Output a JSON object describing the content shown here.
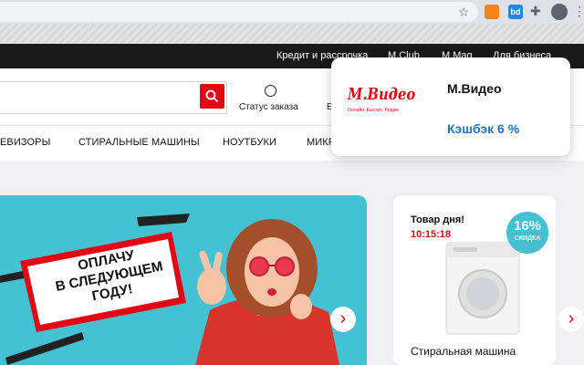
{
  "browser": {
    "extensions": [
      {
        "name": "fox-extension-icon",
        "label": ""
      },
      {
        "name": "bd-extension-icon",
        "label": "bd"
      }
    ]
  },
  "topbar": {
    "links": [
      "Кредит и рассрочка",
      "M.Club",
      "M.Mag",
      "Для бизнеса"
    ]
  },
  "header": {
    "order_status": "Статус заказа",
    "more_label": "Е"
  },
  "nav": {
    "items": [
      "ЕВИЗОРЫ",
      "СТИРАЛЬНЫЕ МАШИНЫ",
      "НОУТБУКИ",
      "МИКР"
    ]
  },
  "banner": {
    "lines": [
      "ОПЛАЧУ",
      "В СЛЕДУЮЩЕМ",
      "ГОДУ!"
    ]
  },
  "deal": {
    "title": "Товар дня!",
    "timer": "10:15:18",
    "discount": "16%",
    "discount_label": "СКИДКА",
    "product_name": "Стиральная машина"
  },
  "popup": {
    "logo_text": "М.Видео",
    "logo_tagline": "Онлайн. Быстро. Рядом.",
    "store_name": "М.Видео",
    "cashback": "Кэшбэк 6 %"
  },
  "colors": {
    "brand_red": "#e30613",
    "banner_bg": "#45c1d4",
    "cashback_blue": "#1f72c4",
    "topbar_bg": "#1a1a1a"
  }
}
